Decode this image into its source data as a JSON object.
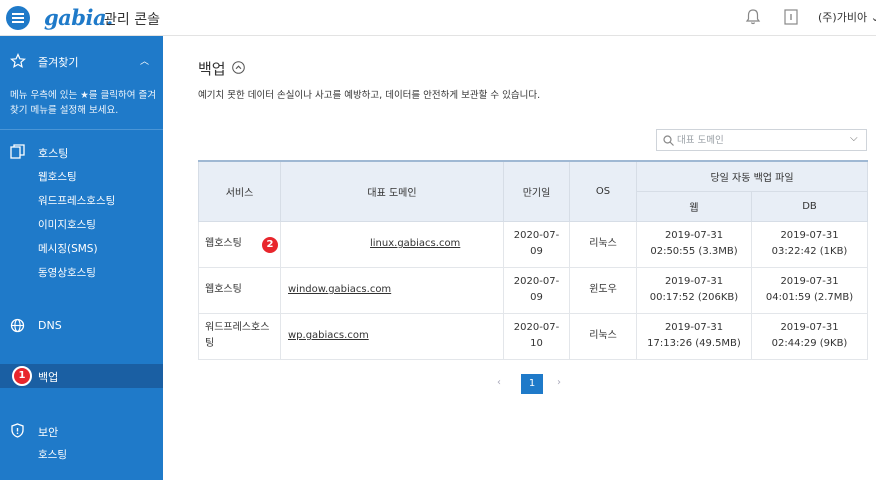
{
  "header": {
    "logo": "gabia.",
    "title": "관리 콘솔",
    "account": "(주)가비아"
  },
  "icons": [
    "menu-icon",
    "bell-icon",
    "document-icon",
    "star-icon",
    "server-icon",
    "globe-icon",
    "shield-icon",
    "search-icon",
    "chevron-up-icon",
    "chevron-down-icon"
  ],
  "colors": {
    "primary": "#1f7ac9",
    "active": "#1a5fa3",
    "badge": "#e8262c"
  },
  "sidebar": {
    "favorites": {
      "label": "즐겨찾기",
      "description": "메뉴 우측에 있는 ★를 클릭하여 즐겨찾기 메뉴를 설정해 보세요."
    },
    "hosting": {
      "label": "호스팅",
      "items": [
        "웹호스팅",
        "워드프레스호스팅",
        "이미지호스팅",
        "메시징(SMS)",
        "동영상호스팅"
      ]
    },
    "dns": {
      "label": "DNS"
    },
    "backup": {
      "label": "백업",
      "badge": "1"
    },
    "security": {
      "label": "보안",
      "items": [
        "호스팅"
      ]
    }
  },
  "main": {
    "title": "백업",
    "description": "예기치 못한 데이터 손실이나 사고를 예방하고, 데이터를 안전하게 보관할 수 있습니다.",
    "search": {
      "placeholder": "대표 도메인"
    },
    "table": {
      "headers": {
        "service": "서비스",
        "domain": "대표 도메인",
        "expiry": "만기일",
        "os": "OS",
        "backup_files": "당일 자동 백업 파일",
        "web": "웹",
        "db": "DB"
      },
      "rows": [
        {
          "service": "웹호스팅",
          "domain": "linux.gabiacs.com",
          "expiry": [
            "2020-07-",
            "09"
          ],
          "os": "리눅스",
          "web": [
            "2019-07-31",
            "02:50:55 (3.3MB)"
          ],
          "db": [
            "2019-07-31",
            "03:22:42 (1KB)"
          ]
        },
        {
          "service": "웹호스팅",
          "domain": "window.gabiacs.com",
          "expiry": [
            "2020-07-",
            "09"
          ],
          "os": "윈도우",
          "web": [
            "2019-07-31",
            "00:17:52 (206KB)"
          ],
          "db": [
            "2019-07-31",
            "04:01:59 (2.7MB)"
          ]
        },
        {
          "service": [
            "워드프레스호스",
            "팅"
          ],
          "domain": "wp.gabiacs.com",
          "expiry": [
            "2020-07-",
            "10"
          ],
          "os": "리눅스",
          "web": [
            "2019-07-31",
            "17:13:26 (49.5MB)"
          ],
          "db": [
            "2019-07-31",
            "02:44:29 (9KB)"
          ]
        }
      ]
    },
    "row_badge": "2",
    "pagination": {
      "prev": "‹",
      "current": "1",
      "next": "›"
    }
  }
}
